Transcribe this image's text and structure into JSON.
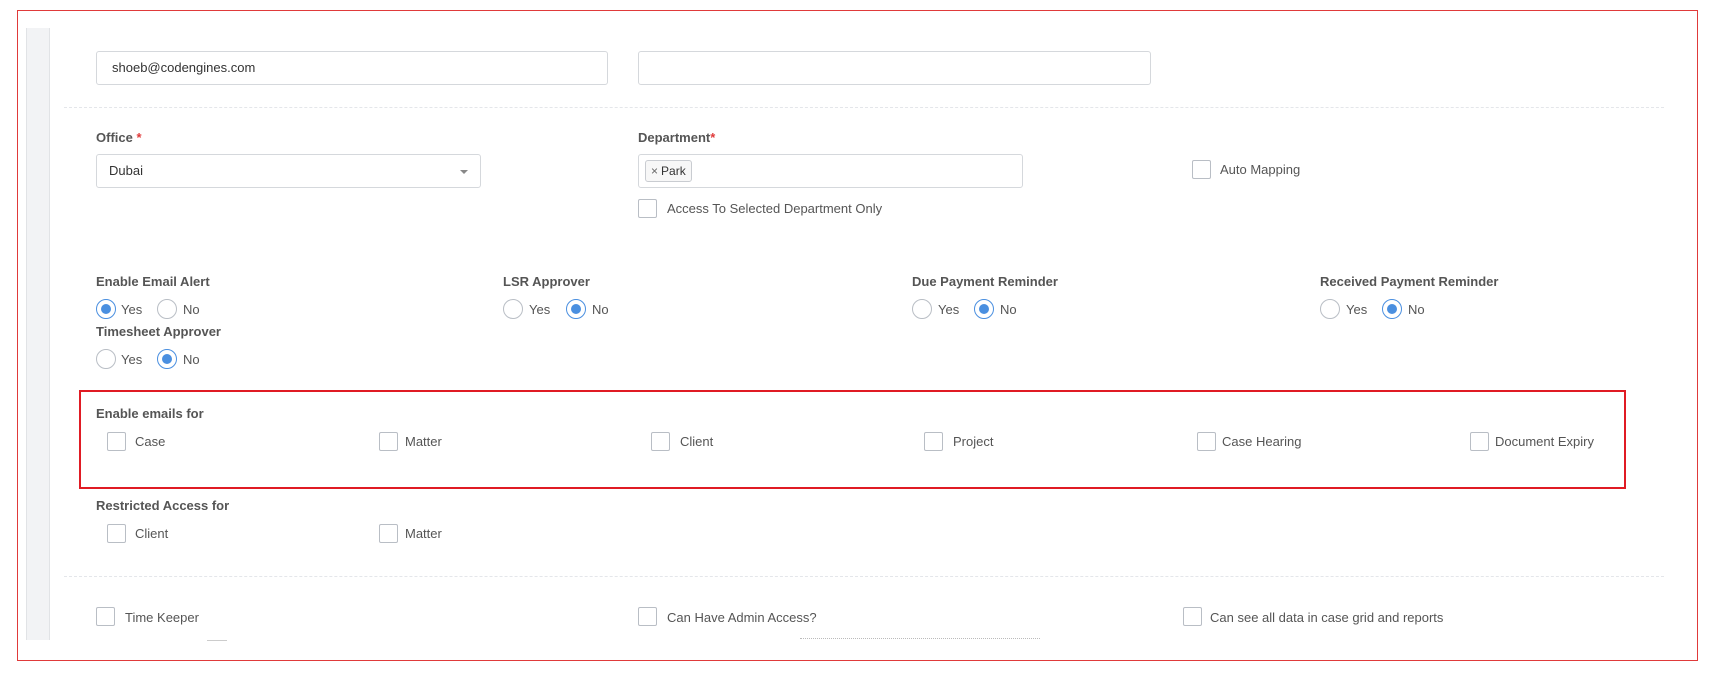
{
  "email": {
    "value": "shoeb@codengines.com",
    "second_value": ""
  },
  "office": {
    "label": "Office",
    "required_mark": "*",
    "value": "Dubai"
  },
  "department": {
    "label": "Department",
    "required_mark": "*",
    "tag": "Park",
    "tag_remove": "×",
    "access_selected_only": "Access To Selected Department Only"
  },
  "auto_mapping": "Auto Mapping",
  "radio_groups": [
    {
      "label": "Enable Email Alert",
      "yes": "Yes",
      "no": "No",
      "selected": "Yes"
    },
    {
      "label": "LSR Approver",
      "yes": "Yes",
      "no": "No",
      "selected": "No"
    },
    {
      "label": "Due Payment Reminder",
      "yes": "Yes",
      "no": "No",
      "selected": "No"
    },
    {
      "label": "Received Payment Reminder",
      "yes": "Yes",
      "no": "No",
      "selected": "No"
    },
    {
      "label": "Timesheet Approver",
      "yes": "Yes",
      "no": "No",
      "selected": "No"
    }
  ],
  "enable_emails": {
    "label": "Enable emails for",
    "options": [
      "Case",
      "Matter",
      "Client",
      "Project",
      "Case Hearing",
      "Document Expiry"
    ]
  },
  "restricted_access": {
    "label": "Restricted Access for",
    "options": [
      "Client",
      "Matter"
    ]
  },
  "bottom": {
    "time_keeper": "Time Keeper",
    "admin_access": "Can Have Admin Access?",
    "see_all_data": "Can see all data in case grid and reports"
  },
  "colors": {
    "accent": "#4a8fe0",
    "highlight": "#e01b24",
    "required": "#e03a3a"
  }
}
